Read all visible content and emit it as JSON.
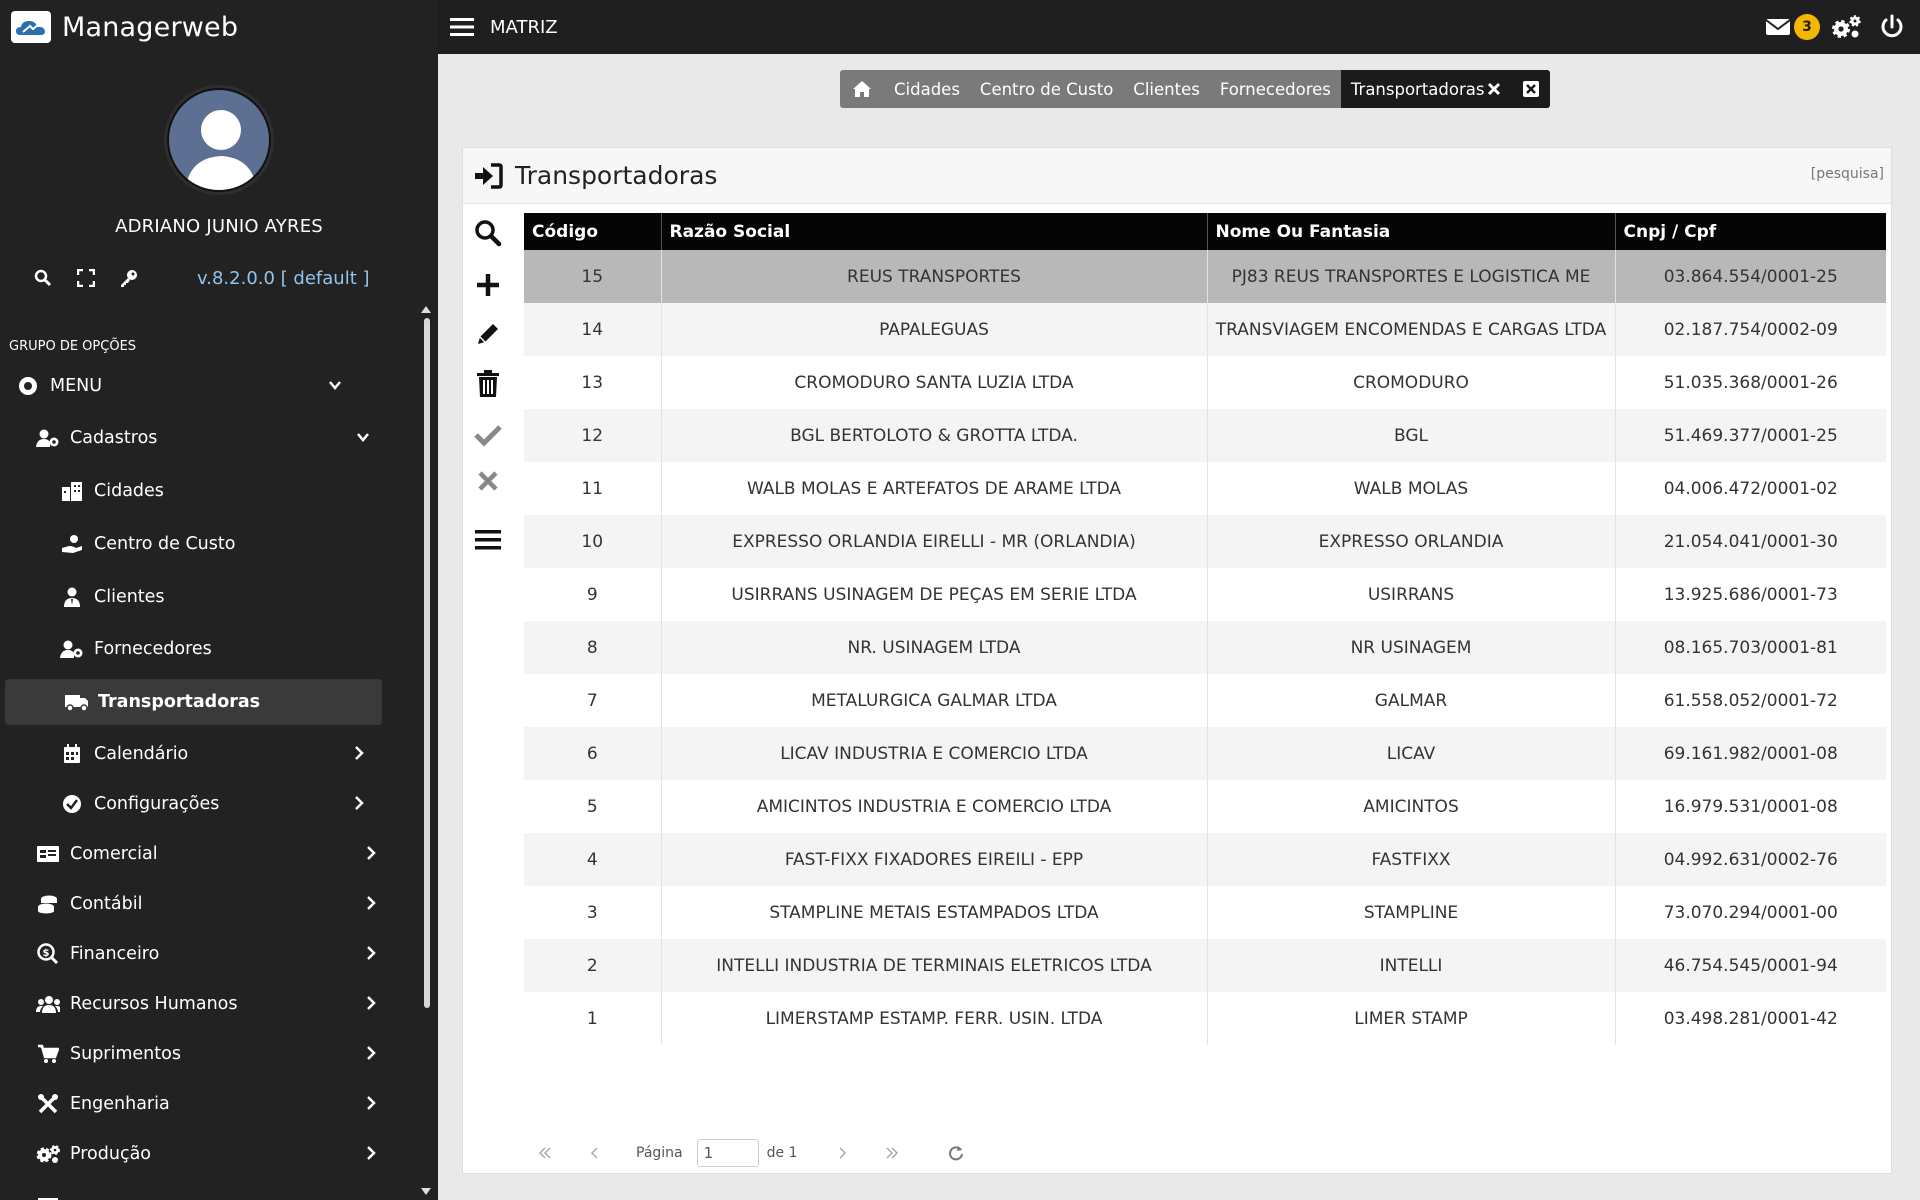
{
  "app": {
    "name": "Managerweb",
    "context": "MATRIZ"
  },
  "user": {
    "name": "ADRIANO JUNIO AYRES",
    "version": "v.8.2.0.0 [ default ]"
  },
  "sidebar": {
    "group_label": "GRUPO DE OPÇÕES",
    "items": [
      {
        "label": "MENU",
        "icon": "circle-dot-icon",
        "level": 0
      },
      {
        "label": "Cadastros",
        "icon": "users-cog-icon",
        "level": 1
      },
      {
        "label": "Cidades",
        "icon": "city-icon",
        "level": 2
      },
      {
        "label": "Centro de Custo",
        "icon": "hand-money-icon",
        "level": 2
      },
      {
        "label": "Clientes",
        "icon": "user-tie-icon",
        "level": 2
      },
      {
        "label": "Fornecedores",
        "icon": "users-cog-icon",
        "level": 2
      },
      {
        "label": "Transportadoras",
        "icon": "truck-icon",
        "level": 2,
        "active": true
      },
      {
        "label": "Calendário",
        "icon": "calendar-icon",
        "level": 2
      },
      {
        "label": "Configurações",
        "icon": "check-circle-icon",
        "level": 2
      },
      {
        "label": "Comercial",
        "icon": "id-card-icon",
        "level": 1
      },
      {
        "label": "Contábil",
        "icon": "coins-icon",
        "level": 1
      },
      {
        "label": "Financeiro",
        "icon": "search-dollar-icon",
        "level": 1
      },
      {
        "label": "Recursos Humanos",
        "icon": "users-icon",
        "level": 1
      },
      {
        "label": "Suprimentos",
        "icon": "cart-icon",
        "level": 1
      },
      {
        "label": "Engenharia",
        "icon": "tools-icon",
        "level": 1
      },
      {
        "label": "Produção",
        "icon": "cogs-icon",
        "level": 1
      }
    ]
  },
  "topbar": {
    "notification_count": "3"
  },
  "tabs": [
    {
      "label": "Cidades"
    },
    {
      "label": "Centro de Custo"
    },
    {
      "label": "Clientes"
    },
    {
      "label": "Fornecedores"
    },
    {
      "label": "Transportadoras",
      "active": true
    }
  ],
  "panel": {
    "title": "Transportadoras",
    "search_link": "[pesquisa]"
  },
  "table": {
    "columns": [
      "Código",
      "Razão Social",
      "Nome Ou Fantasia",
      "Cnpj / Cpf"
    ],
    "rows": [
      [
        "15",
        "REUS TRANSPORTES",
        "PJ83 REUS TRANSPORTES E LOGISTICA ME",
        "03.864.554/0001-25"
      ],
      [
        "14",
        "PAPALEGUAS",
        "TRANSVIAGEM ENCOMENDAS E CARGAS LTDA",
        "02.187.754/0002-09"
      ],
      [
        "13",
        "CROMODURO SANTA LUZIA LTDA",
        "CROMODURO",
        "51.035.368/0001-26"
      ],
      [
        "12",
        "BGL BERTOLOTO & GROTTA LTDA.",
        "BGL",
        "51.469.377/0001-25"
      ],
      [
        "11",
        "WALB MOLAS E ARTEFATOS DE ARAME LTDA",
        "WALB MOLAS",
        "04.006.472/0001-02"
      ],
      [
        "10",
        "EXPRESSO ORLANDIA EIRELLI - MR (ORLANDIA)",
        "EXPRESSO ORLANDIA",
        "21.054.041/0001-30"
      ],
      [
        "9",
        "USIRRANS USINAGEM DE PEÇAS EM SERIE LTDA",
        "USIRRANS",
        "13.925.686/0001-73"
      ],
      [
        "8",
        "NR. USINAGEM LTDA",
        "NR USINAGEM",
        "08.165.703/0001-81"
      ],
      [
        "7",
        "METALURGICA GALMAR LTDA",
        "GALMAR",
        "61.558.052/0001-72"
      ],
      [
        "6",
        "LICAV INDUSTRIA E COMERCIO LTDA",
        "LICAV",
        "69.161.982/0001-08"
      ],
      [
        "5",
        "AMICINTOS INDUSTRIA E COMERCIO LTDA",
        "AMICINTOS",
        "16.979.531/0001-08"
      ],
      [
        "4",
        "FAST-FIXX FIXADORES EIREILI - EPP",
        "FASTFIXX",
        "04.992.631/0002-76"
      ],
      [
        "3",
        "STAMPLINE METAIS ESTAMPADOS LTDA",
        "STAMPLINE",
        "73.070.294/0001-00"
      ],
      [
        "2",
        "INTELLI INDUSTRIA DE TERMINAIS ELETRICOS LTDA",
        "INTELLI",
        "46.754.545/0001-94"
      ],
      [
        "1",
        "LIMERSTAMP ESTAMP. FERR. USIN. LTDA",
        "LIMER STAMP",
        "03.498.281/0001-42"
      ]
    ]
  },
  "pager": {
    "page_label": "Página",
    "page_value": "1",
    "of_label": "de 1"
  }
}
